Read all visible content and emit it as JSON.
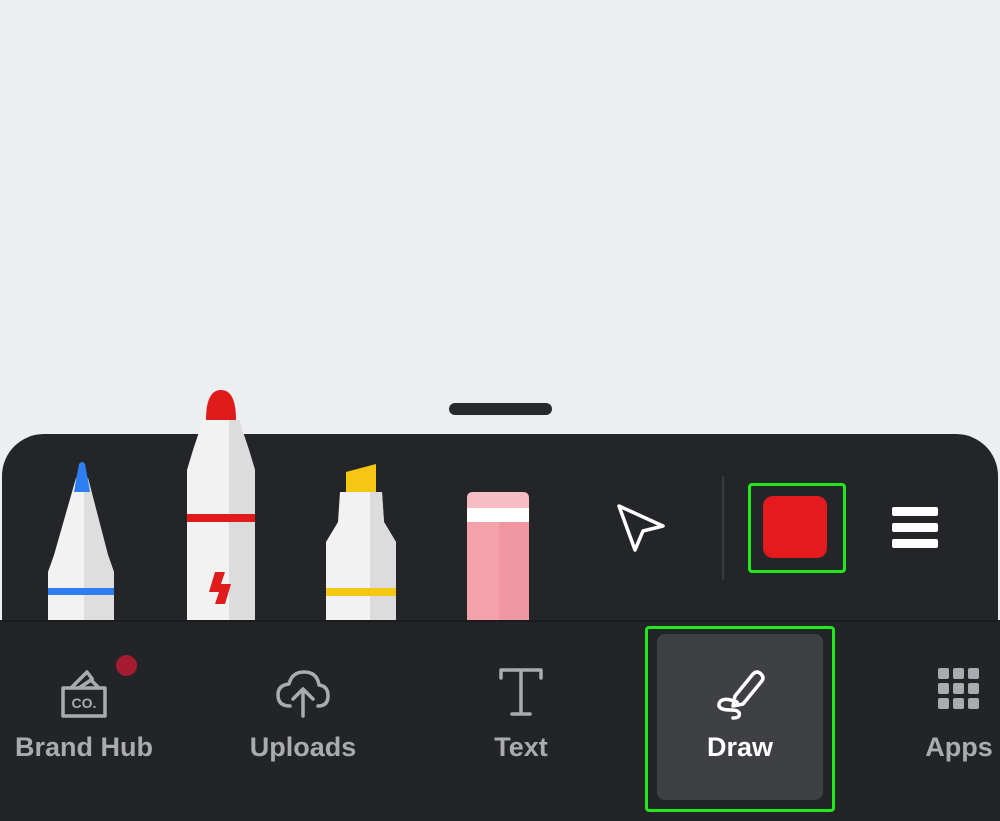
{
  "draw_tools": {
    "pen": {
      "name": "pen",
      "tip_color": "#2d7ef0"
    },
    "marker": {
      "name": "marker",
      "tip_color": "#e01b1b"
    },
    "highlighter": {
      "name": "highlighter",
      "tip_color": "#f7c613"
    },
    "eraser": {
      "name": "eraser",
      "color": "#f4a1ab"
    },
    "select": {
      "icon": "pointer-arrow-icon"
    }
  },
  "color_picker": {
    "selected_color": "#e51a1f"
  },
  "menu": {
    "icon": "hamburger-menu-icon"
  },
  "bottom_nav": {
    "items": [
      {
        "id": "brand-hub",
        "label": "Brand Hub",
        "icon": "brand-kit-icon",
        "has_notification": true
      },
      {
        "id": "uploads",
        "label": "Uploads",
        "icon": "cloud-upload-icon"
      },
      {
        "id": "text",
        "label": "Text",
        "icon": "text-icon"
      },
      {
        "id": "draw",
        "label": "Draw",
        "icon": "draw-icon",
        "active": true
      },
      {
        "id": "apps",
        "label": "Apps",
        "icon": "apps-grid-icon"
      }
    ]
  },
  "colors": {
    "highlight": "#1fe81c",
    "panel": "#242528",
    "active_nav": "#3f4044",
    "notification": "#a51c30"
  }
}
